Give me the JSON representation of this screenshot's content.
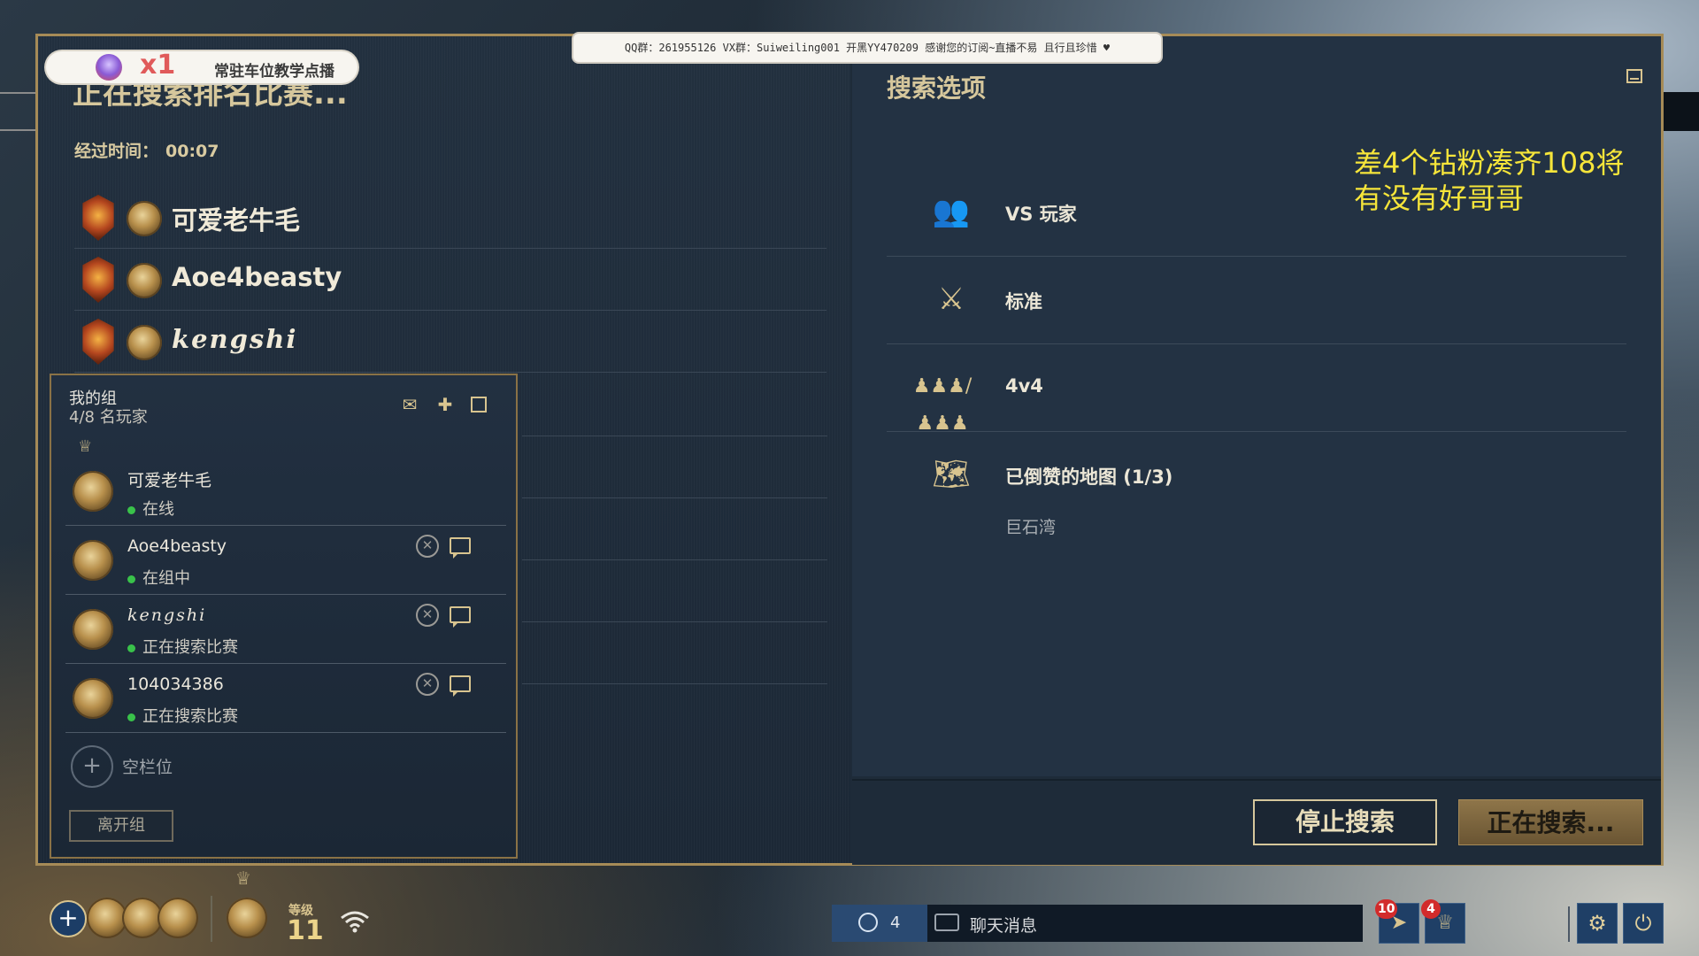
{
  "search": {
    "title": "正在搜索排名比赛...",
    "elapsed_label": "经过时间：",
    "elapsed_value": "00:07"
  },
  "players": [
    {
      "name": "可爱老牛毛"
    },
    {
      "name": "Aoe4beasty"
    },
    {
      "name": "kengshi"
    }
  ],
  "group": {
    "title": "我的组",
    "count": "4/8 名玩家",
    "members": [
      {
        "name": "可爱老牛毛",
        "status": "在线",
        "leader": true
      },
      {
        "name": "Aoe4beasty",
        "status": "在组中"
      },
      {
        "name": "kengshi",
        "status": "正在搜索比赛"
      },
      {
        "name": "104034386",
        "status": "正在搜索比赛"
      }
    ],
    "empty_slot_label": "空栏位",
    "leave_label": "离开组"
  },
  "options": {
    "title": "搜索选项",
    "rows": [
      {
        "label": "VS 玩家",
        "icon": "players-icon"
      },
      {
        "label": "标准",
        "icon": "crossed-swords-icon"
      },
      {
        "label": "4v4",
        "icon": "team-vs-icon"
      },
      {
        "label": "已倒赞的地图 (1/3)",
        "icon": "map-icon",
        "sub": "巨石湾"
      }
    ]
  },
  "overlay": {
    "line1": "差4个钻粉凑齐108将",
    "line2": "有没有好哥哥"
  },
  "buttons": {
    "stop": "停止搜索",
    "searching": "正在搜索..."
  },
  "stream_banner": "QQ群：261955126 VX群：Suiweiling001 开黑YY470209 感谢您的订阅~直播不易 且行且珍惜 ♥",
  "tip_banner": {
    "multiplier": "x1",
    "text": "常驻车位教学点播"
  },
  "bottom_bar": {
    "level_label": "等级",
    "level_value": "11",
    "friends_count": "4",
    "chat_label": "聊天消息",
    "notif_badges": [
      "10",
      "4"
    ]
  },
  "colors": {
    "accent_gold": "#d6c79c",
    "online_green": "#39c24a",
    "overlay_yellow": "#f6e53a",
    "badge_red": "#d22b2b"
  }
}
